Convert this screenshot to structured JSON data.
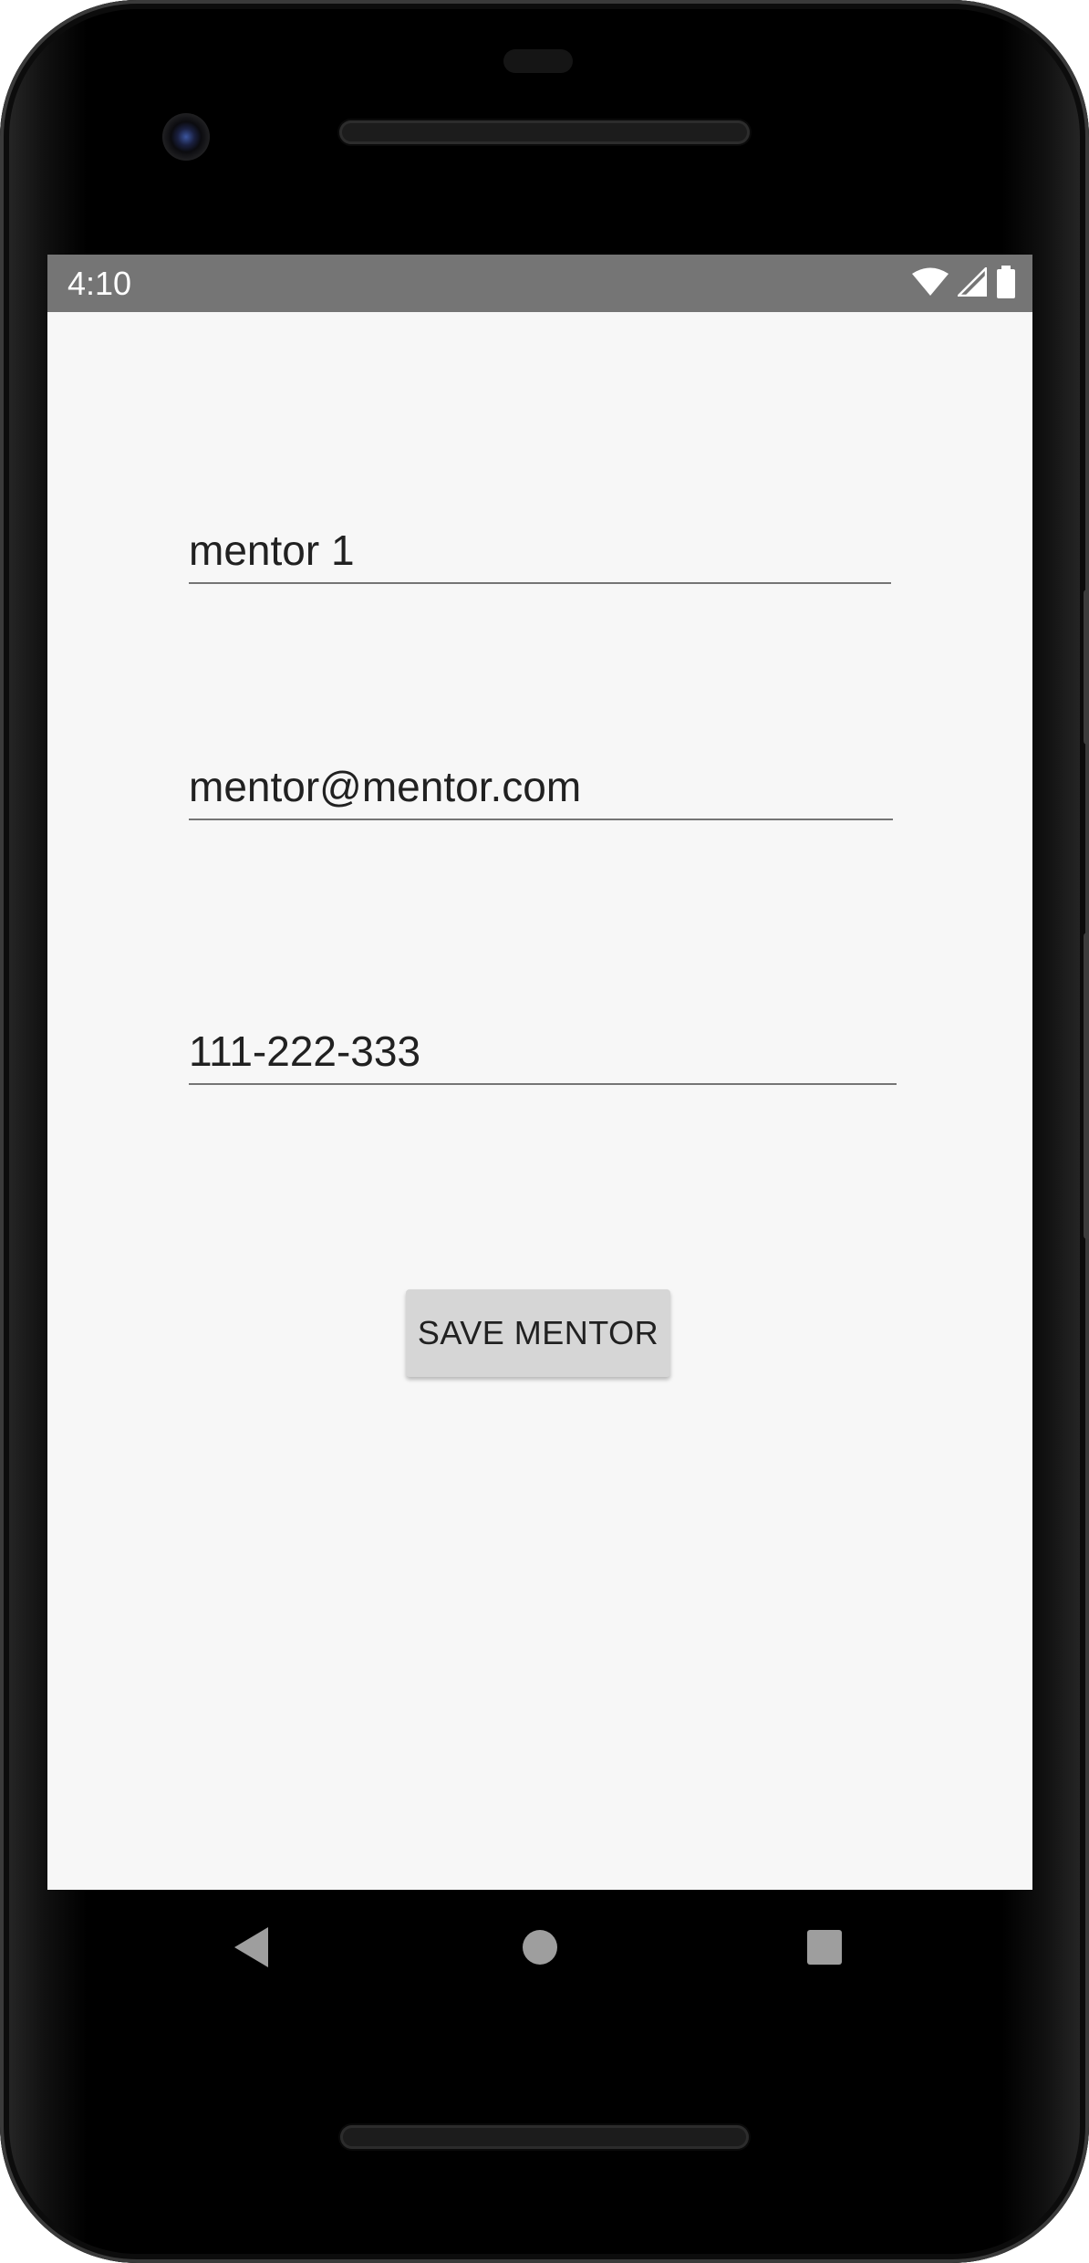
{
  "status_bar": {
    "time": "4:10",
    "icons": [
      "wifi-icon",
      "cell-signal-icon",
      "battery-icon"
    ],
    "background": "#757575"
  },
  "form": {
    "name_value": "mentor 1",
    "email_value": "mentor@mentor.com",
    "phone_value": "111-222-333",
    "save_label": "SAVE MENTOR"
  },
  "nav_bar": {
    "icons": [
      "back-icon",
      "home-icon",
      "recents-icon"
    ]
  },
  "colors": {
    "screen_background": "#f7f7f7",
    "button_background": "#d6d6d6",
    "underline": "#757575"
  }
}
